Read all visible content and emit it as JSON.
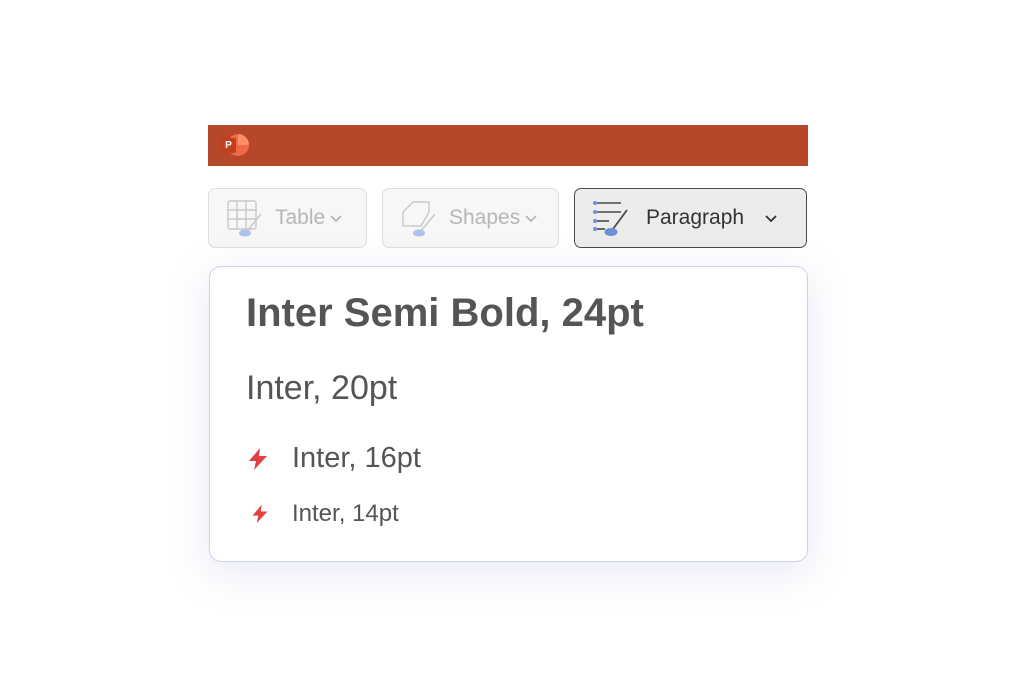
{
  "app": {
    "logo_letter": "P",
    "titlebar_color": "#b7472a"
  },
  "toolbar": {
    "buttons": [
      {
        "label": "Table",
        "icon": "table-brush-icon",
        "state": "disabled"
      },
      {
        "label": "Shapes",
        "icon": "shapes-brush-icon",
        "state": "disabled"
      },
      {
        "label": "Paragraph",
        "icon": "paragraph-brush-icon",
        "state": "active"
      }
    ]
  },
  "dropdown": {
    "items": [
      {
        "label": "Inter Semi Bold, 24pt",
        "icon": null
      },
      {
        "label": "Inter, 20pt",
        "icon": null
      },
      {
        "label": "Inter, 16pt",
        "icon": "lightning-icon"
      },
      {
        "label": "Inter, 14pt",
        "icon": "lightning-icon"
      }
    ],
    "accent_color": "#e0403f"
  }
}
